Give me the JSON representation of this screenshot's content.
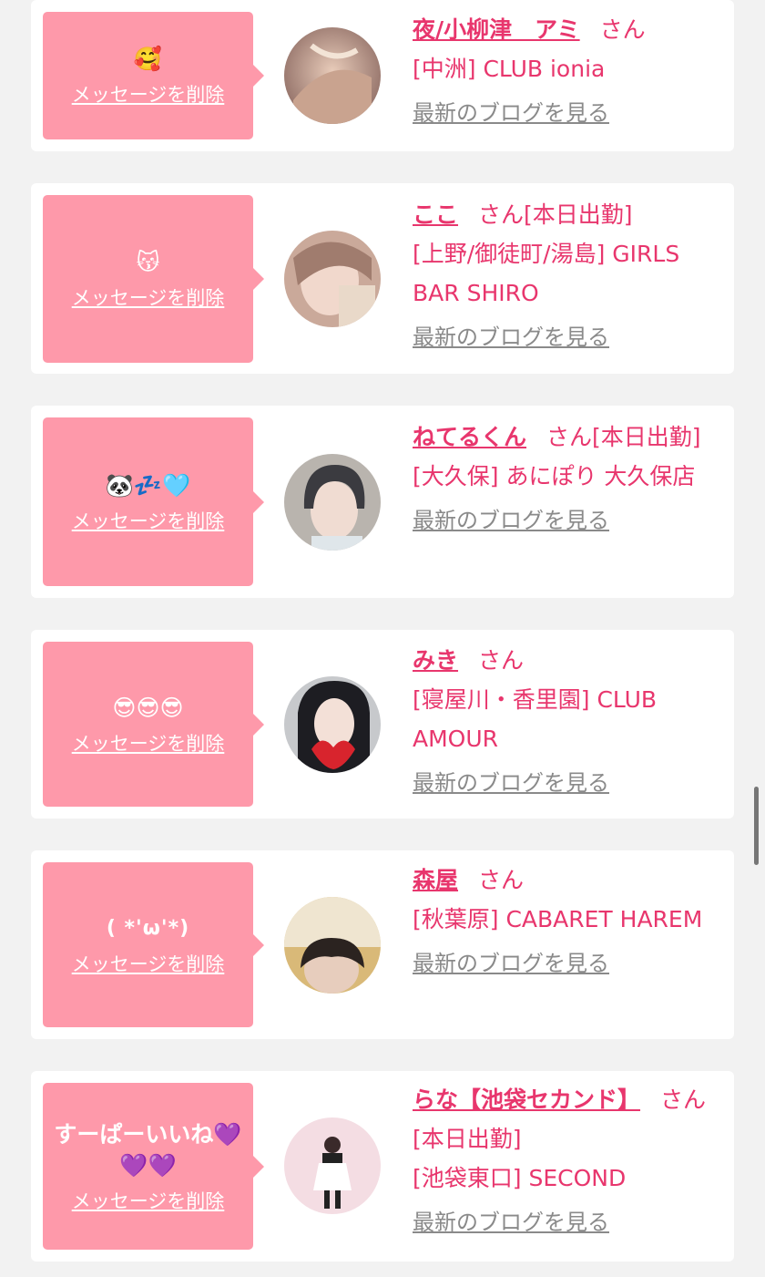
{
  "ui": {
    "delete_label": "メッセージを削除",
    "blog_label": "最新のブログを見る",
    "honorific": "さん"
  },
  "colors": {
    "bubble": "#fe99aa",
    "accent": "#e8366d",
    "link_gray": "#8a8a8a",
    "card": "#ffffff",
    "page_bg": "#f2f2f2"
  },
  "items": [
    {
      "message": "🥰",
      "name": "夜/小柳津　アミ",
      "status": "",
      "shop": "[中洲] CLUB ionia",
      "avatar_icon": "photo-avatar"
    },
    {
      "message": "😽",
      "name": "ここ",
      "status": "[本日出勤]",
      "shop": "[上野/御徒町/湯島] GIRLS BAR SHIRO",
      "avatar_icon": "photo-avatar"
    },
    {
      "message": "🐼💤🩵",
      "name": "ねてるくん",
      "status": "[本日出勤]",
      "shop": "[大久保] あにぽり 大久保店",
      "avatar_icon": "photo-avatar"
    },
    {
      "message": "😎😎😎",
      "name": "みき",
      "status": "",
      "shop": "[寝屋川・香里園] CLUB AMOUR",
      "avatar_icon": "photo-avatar"
    },
    {
      "message": "( *'ω'*)",
      "name": "森屋",
      "status": "",
      "shop": "[秋葉原] CABARET HAREM",
      "avatar_icon": "photo-avatar"
    },
    {
      "message": "すーぱーいいね💜💜💜",
      "name": "らな【池袋セカンド】",
      "status": "[本日出勤]",
      "shop": "[池袋東口] SECOND",
      "avatar_icon": "photo-avatar"
    }
  ]
}
